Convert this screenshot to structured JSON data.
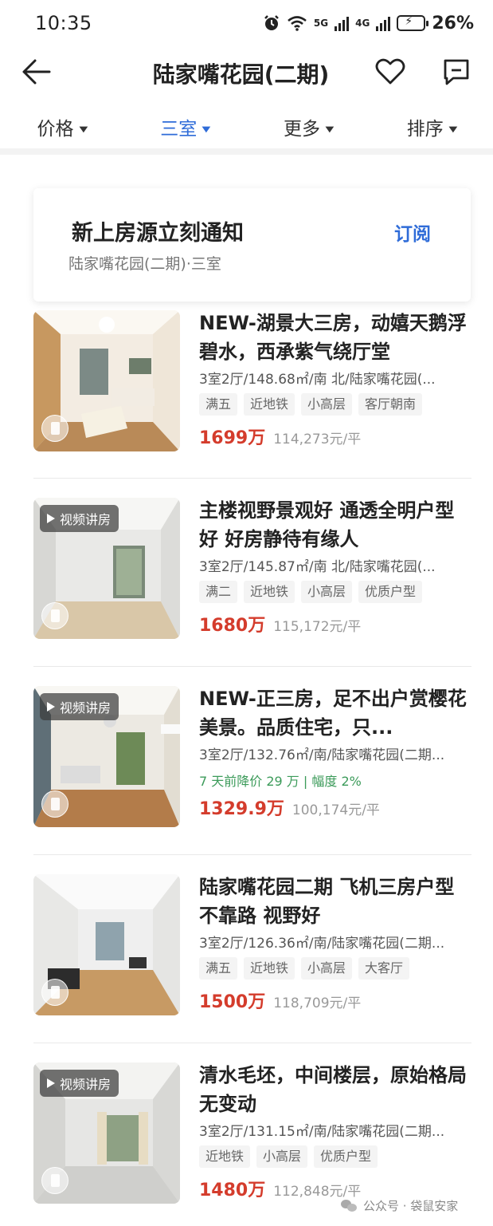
{
  "status_bar": {
    "time": "10:35",
    "network_a": "5G",
    "network_b": "4G",
    "battery": "26%"
  },
  "header": {
    "title": "陆家嘴花园(二期)"
  },
  "filters": [
    {
      "label": "价格",
      "active": false
    },
    {
      "label": "三室",
      "active": true
    },
    {
      "label": "更多",
      "active": false
    },
    {
      "label": "排序",
      "active": false
    }
  ],
  "subscribe": {
    "title": "新上房源立刻通知",
    "description": "陆家嘴花园(二期)·三室",
    "button": "订阅"
  },
  "listings": [
    {
      "title": "NEW-湖景大三房，动嬉天鹅浮碧水，西承紫气绕厅堂",
      "meta": "3室2厅/148.68㎡/南 北/陆家嘴花园(...",
      "tags": [
        "满五",
        "近地铁",
        "小高层",
        "客厅朝南"
      ],
      "price": "1699万",
      "unit_price": "114,273元/平",
      "video_badge": ""
    },
    {
      "title": "主楼视野景观好 通透全明户型好 好房静待有缘人",
      "meta": "3室2厅/145.87㎡/南 北/陆家嘴花园(...",
      "tags": [
        "满二",
        "近地铁",
        "小高层",
        "优质户型"
      ],
      "price": "1680万",
      "unit_price": "115,172元/平",
      "video_badge": "视频讲房"
    },
    {
      "title": "NEW-正三房，足不出户赏樱花美景。品质住宅，只...",
      "meta": "3室2厅/132.76㎡/南/陆家嘴花园(二期...",
      "price_drop": "7 天前降价 29 万 | 幅度 2%",
      "price": "1329.9万",
      "unit_price": "100,174元/平",
      "video_badge": "视频讲房"
    },
    {
      "title": "陆家嘴花园二期 飞机三房户型 不靠路 视野好",
      "meta": "3室2厅/126.36㎡/南/陆家嘴花园(二期...",
      "tags": [
        "满五",
        "近地铁",
        "小高层",
        "大客厅"
      ],
      "price": "1500万",
      "unit_price": "118,709元/平",
      "video_badge": ""
    },
    {
      "title": "清水毛坯，中间楼层，原始格局无变动",
      "meta": "3室2厅/131.15㎡/南/陆家嘴花园(二期...",
      "tags": [
        "近地铁",
        "小高层",
        "优质户型"
      ],
      "price": "1480万",
      "unit_price": "112,848元/平",
      "video_badge": "视频讲房"
    }
  ],
  "watermark": "公众号 · 袋鼠安家",
  "colors": {
    "accent": "#2f6cd8",
    "price": "#d43c2c",
    "price_drop": "#3c9b5a"
  }
}
